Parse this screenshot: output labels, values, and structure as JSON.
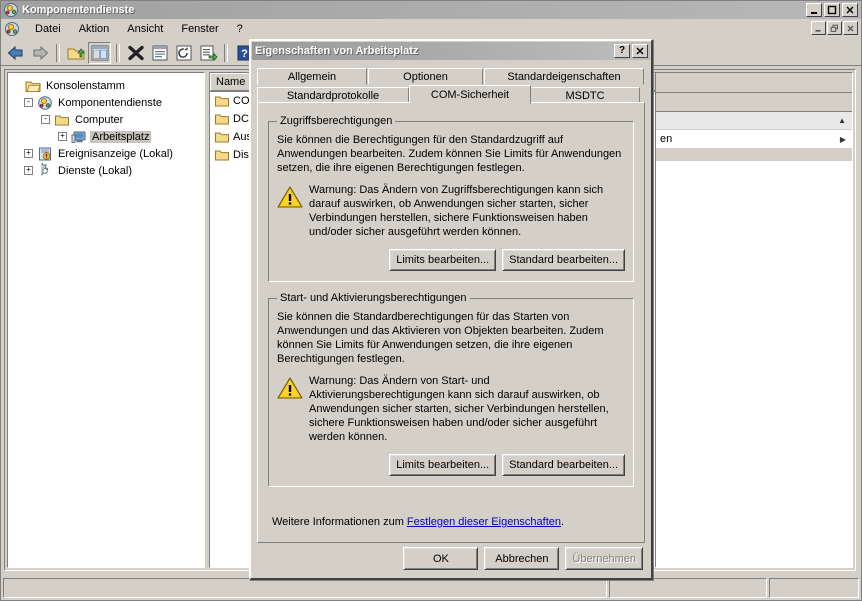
{
  "window": {
    "title": "Komponentendienste",
    "icon": "components-icon",
    "buttons": [
      {
        "name": "minimize-button",
        "glyph": "_"
      },
      {
        "name": "maximize-button",
        "glyph": "□"
      },
      {
        "name": "close-button",
        "glyph": "✕"
      }
    ]
  },
  "menubar": {
    "icon": "console-icon",
    "items": [
      "Datei",
      "Aktion",
      "Ansicht",
      "Fenster",
      "?"
    ],
    "mdi_buttons": [
      {
        "name": "mdi-minimize-button",
        "glyph": "_"
      },
      {
        "name": "mdi-restore-button",
        "glyph": "❐"
      },
      {
        "name": "mdi-close-button",
        "glyph": "✕"
      }
    ]
  },
  "toolbar": {
    "buttons": [
      {
        "name": "back-button",
        "icon": "back-arrow-icon"
      },
      {
        "name": "forward-button",
        "icon": "forward-arrow-icon"
      },
      {
        "name": "up-one-level-button",
        "icon": "folder-up-icon"
      },
      {
        "name": "show-hide-tree-button",
        "icon": "console-tree-icon"
      },
      {
        "name": "delete-button",
        "icon": "delete-x-icon"
      },
      {
        "name": "properties-button",
        "icon": "properties-icon"
      },
      {
        "name": "refresh-button",
        "icon": "refresh-icon"
      },
      {
        "name": "export-list-button",
        "icon": "export-list-icon"
      },
      {
        "name": "help-button",
        "icon": "help-question-icon"
      },
      {
        "name": "view-button",
        "icon": "view-icon"
      }
    ]
  },
  "tree": {
    "nodes": [
      {
        "label": "Konsolenstamm",
        "icon": "folder-open-icon",
        "indent": 0,
        "expander": "",
        "selected": false
      },
      {
        "label": "Komponentendienste",
        "icon": "components-icon",
        "indent": 1,
        "expander": "-",
        "selected": false
      },
      {
        "label": "Computer",
        "icon": "folder-icon",
        "indent": 2,
        "expander": "-",
        "selected": false
      },
      {
        "label": "Arbeitsplatz",
        "icon": "computer-icon",
        "indent": 3,
        "expander": "+",
        "selected": true
      },
      {
        "label": "Ereignisanzeige (Lokal)",
        "icon": "eventviewer-icon",
        "indent": 1,
        "expander": "+",
        "selected": false
      },
      {
        "label": "Dienste (Lokal)",
        "icon": "services-icon",
        "indent": 1,
        "expander": "+",
        "selected": false
      }
    ]
  },
  "list": {
    "columns": [
      "Name"
    ],
    "rows": [
      {
        "label": "COM+",
        "icon": "folder-icon"
      },
      {
        "label": "DCOM",
        "icon": "folder-icon"
      },
      {
        "label": "Ausg",
        "icon": "folder-icon"
      },
      {
        "label": "Distr",
        "icon": "folder-icon"
      }
    ]
  },
  "right_pane": {
    "text_fragment": "en",
    "scroll_up_glyph": "▲",
    "row_arrow_glyph": "▶"
  },
  "statusbar": {
    "panes": [
      "",
      "",
      ""
    ]
  },
  "dialog": {
    "title": "Eigenschaften von Arbeitsplatz",
    "title_buttons": [
      {
        "name": "dialog-help-button",
        "glyph": "?"
      },
      {
        "name": "dialog-close-button",
        "glyph": "✕"
      }
    ],
    "tabs_row1": [
      {
        "label": "Allgemein",
        "active": false
      },
      {
        "label": "Optionen",
        "active": false
      },
      {
        "label": "Standardeigenschaften",
        "active": false
      }
    ],
    "tabs_row2": [
      {
        "label": "Standardprotokolle",
        "active": false
      },
      {
        "label": "COM-Sicherheit",
        "active": true
      },
      {
        "label": "MSDTC",
        "active": false
      }
    ],
    "group_access": {
      "legend": "Zugriffsberechtigungen",
      "description": "Sie können die Berechtigungen für den Standardzugriff auf Anwendungen bearbeiten. Zudem können Sie Limits für Anwendungen setzen, die ihre eigenen Berechtigungen festlegen.",
      "warning_icon": "warning-triangle-icon",
      "warning": "Warnung: Das Ändern von Zugriffsberechtigungen kann sich darauf auswirken, ob Anwendungen sicher starten, sicher Verbindungen herstellen, sichere Funktionsweisen haben und/oder sicher ausgeführt werden können.",
      "button_limits": "Limits bearbeiten...",
      "button_default": "Standard bearbeiten..."
    },
    "group_launch": {
      "legend": "Start- und Aktivierungsberechtigungen",
      "description": "Sie können die Standardberechtigungen für das Starten von Anwendungen und das Aktivieren von Objekten bearbeiten. Zudem können Sie Limits für Anwendungen setzen, die ihre eigenen Berechtigungen festlegen.",
      "warning_icon": "warning-triangle-icon",
      "warning": "Warnung: Das Ändern von Start- und Aktivierungsberechtigungen kann sich darauf auswirken, ob Anwendungen sicher starten, sicher Verbindungen herstellen, sichere Funktionsweisen haben und/oder sicher ausgeführt werden können.",
      "button_limits": "Limits bearbeiten...",
      "button_default": "Standard bearbeiten..."
    },
    "footer": {
      "prefix": "Weitere Informationen zum ",
      "link": "Festlegen dieser Eigenschaften",
      "suffix": ".",
      "link_color": "#0000cc"
    },
    "buttons": {
      "ok": "OK",
      "cancel": "Abbrechen",
      "apply": "Übernehmen",
      "apply_disabled": true
    }
  },
  "colors": {
    "face": "#d4d0c8",
    "title_active": "#a0a0a0",
    "selection": "#c8c4bc",
    "warning_yellow": "#ffcc00"
  }
}
